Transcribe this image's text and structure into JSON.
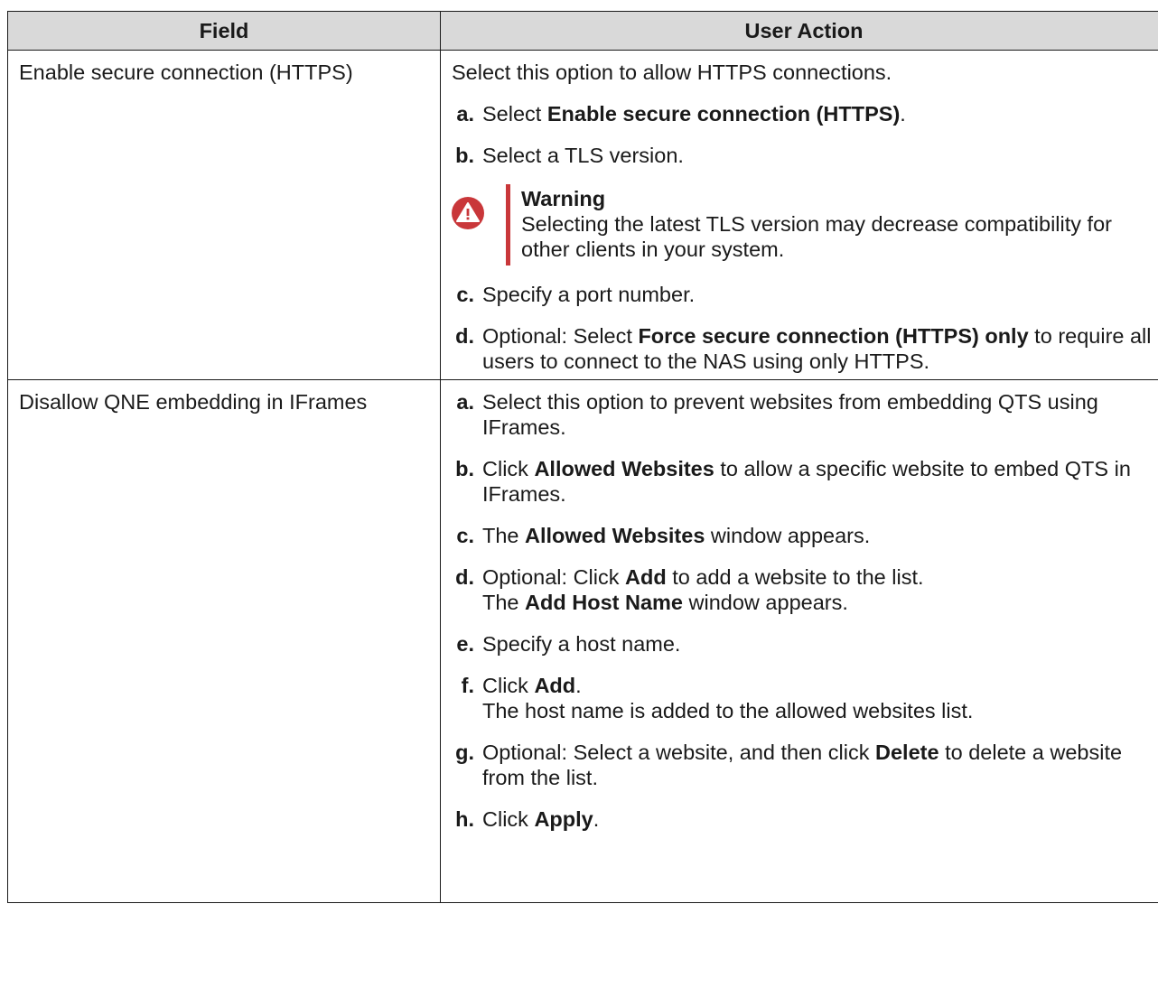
{
  "table": {
    "headers": [
      "Field",
      "User Action"
    ],
    "rows": [
      {
        "field": "Enable secure connection (HTTPS)",
        "intro": "Select this option to allow HTTPS connections.",
        "steps": [
          {
            "label": "a.",
            "pre": "Select ",
            "bold": "Enable secure connection (HTTPS)",
            "post": "."
          },
          {
            "label": "b.",
            "pre": "Select a TLS version.",
            "bold": "",
            "post": ""
          }
        ],
        "warning": {
          "title": "Warning",
          "text": "Selecting the latest TLS version may decrease compatibility for other clients in your system.",
          "icon": "warning-triangle-icon",
          "color": "#c9373a"
        },
        "steps2": [
          {
            "label": "c.",
            "pre": "Specify a port number.",
            "bold": "",
            "post": ""
          },
          {
            "label": "d.",
            "pre": "Optional: Select ",
            "bold": "Force secure connection (HTTPS) only",
            "post": " to require all users to connect to the NAS using only HTTPS."
          }
        ]
      },
      {
        "field": "Disallow QNE embedding in IFrames",
        "steps": [
          {
            "label": "a.",
            "pre": "Select this option to prevent websites from embedding QTS using IFrames.",
            "bold": "",
            "post": ""
          },
          {
            "label": "b.",
            "pre": "Click ",
            "bold": "Allowed Websites",
            "post": " to allow a specific website to embed QTS in IFrames."
          },
          {
            "label": "c.",
            "pre": "The ",
            "bold": "Allowed Websites",
            "post": " window appears."
          },
          {
            "label": "d.",
            "pre": "Optional: Click ",
            "bold": "Add",
            "post": " to add a website to the list.",
            "line2_pre": "The ",
            "line2_bold": "Add Host Name",
            "line2_post": " window appears."
          },
          {
            "label": "e.",
            "pre": "Specify a host name.",
            "bold": "",
            "post": ""
          },
          {
            "label": "f.",
            "pre": "Click ",
            "bold": "Add",
            "post": ".",
            "line2_pre": "The host name is added to the allowed websites list.",
            "line2_bold": "",
            "line2_post": ""
          },
          {
            "label": "g.",
            "pre": "Optional: Select a website, and then click ",
            "bold": "Delete",
            "post": " to delete a website from the list."
          },
          {
            "label": "h.",
            "pre": "Click ",
            "bold": "Apply",
            "post": "."
          }
        ]
      }
    ]
  }
}
